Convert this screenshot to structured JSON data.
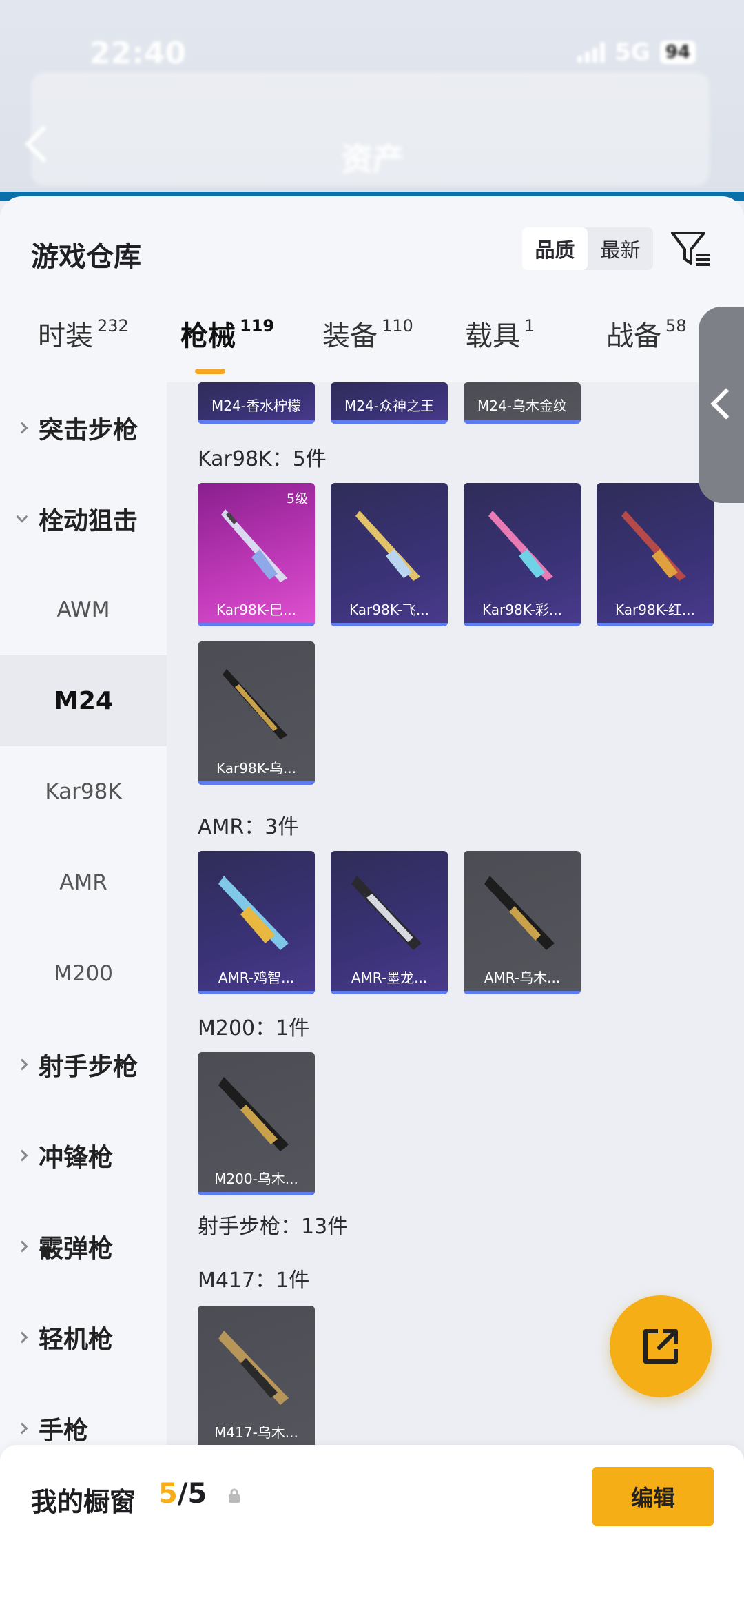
{
  "status_bar": {
    "time": "22:40",
    "carrier": "",
    "network": "5G",
    "battery": "94"
  },
  "app_bar": {
    "title": "资产"
  },
  "sheet": {
    "title": "游戏仓库",
    "sort_options": [
      "品质",
      "最新"
    ],
    "selected_sort": "品质"
  },
  "tabs": [
    {
      "label": "时装",
      "count": "232"
    },
    {
      "label": "枪械",
      "count": "119"
    },
    {
      "label": "装备",
      "count": "110"
    },
    {
      "label": "载具",
      "count": "1"
    },
    {
      "label": "战备",
      "count": "58"
    }
  ],
  "categories": [
    {
      "label": "突击步枪",
      "type": "group",
      "expanded": false
    },
    {
      "label": "栓动狙击",
      "type": "group",
      "expanded": true
    },
    {
      "label": "AWM",
      "type": "sub"
    },
    {
      "label": "M24",
      "type": "sub",
      "selected": true
    },
    {
      "label": "Kar98K",
      "type": "sub"
    },
    {
      "label": "AMR",
      "type": "sub"
    },
    {
      "label": "M200",
      "type": "sub"
    },
    {
      "label": "射手步枪",
      "type": "group",
      "expanded": false
    },
    {
      "label": "冲锋枪",
      "type": "group",
      "expanded": false
    },
    {
      "label": "霰弹枪",
      "type": "group",
      "expanded": false
    },
    {
      "label": "轻机枪",
      "type": "group",
      "expanded": false
    },
    {
      "label": "手枪",
      "type": "group",
      "expanded": false
    }
  ],
  "top_cards": [
    "M24-香水柠檬",
    "M24-众神之王",
    "M24-乌木金纹"
  ],
  "sections": [
    {
      "label": "Kar98K：5件",
      "cards": [
        {
          "name": "Kar98K-巳...",
          "level": "5级"
        },
        {
          "name": "Kar98K-飞..."
        },
        {
          "name": "Kar98K-彩..."
        },
        {
          "name": "Kar98K-红..."
        },
        {
          "name": "Kar98K-乌..."
        }
      ]
    },
    {
      "label": "AMR：3件",
      "cards": [
        {
          "name": "AMR-鸡智..."
        },
        {
          "name": "AMR-墨龙..."
        },
        {
          "name": "AMR-乌木..."
        }
      ]
    },
    {
      "label": "M200：1件",
      "cards": [
        {
          "name": "M200-乌木..."
        }
      ]
    },
    {
      "label": "射手步枪：13件",
      "cards": []
    },
    {
      "label": "M417：1件",
      "cards": [
        {
          "name": "M417-乌木..."
        }
      ]
    }
  ],
  "bottom_bar": {
    "title": "我的橱窗",
    "count_current": "5",
    "count_total": "/5",
    "edit_label": "编辑"
  },
  "colors": {
    "accent": "#f6ae16",
    "tab_indicator": "#f5a623",
    "card_purple": "#3a3277",
    "card_pink": "#c13ab9",
    "card_gray": "#55565d",
    "rarity_bar": "#5e7cf0"
  },
  "icons": {
    "filter": "filter-icon",
    "share": "share-external-icon",
    "lock": "lock-icon",
    "drawer": "chevron-left-icon"
  }
}
